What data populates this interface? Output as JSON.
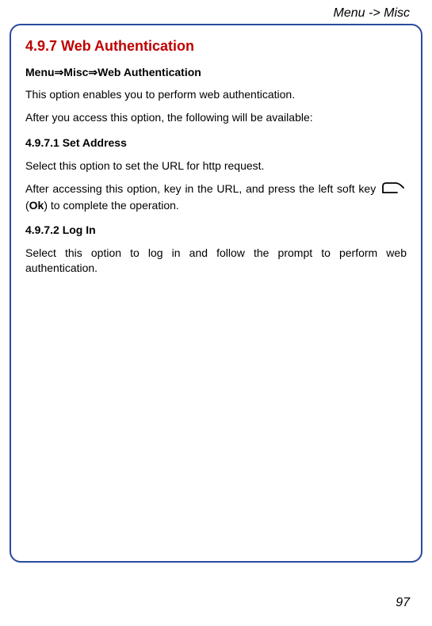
{
  "header": {
    "breadcrumb": "Menu -> Misc"
  },
  "section": {
    "heading": "4.9.7 Web Authentication",
    "path_prefix": "Menu",
    "path_mid": "Misc",
    "path_suffix": "Web Authentication",
    "intro1": "This option enables you to perform web authentication.",
    "intro2": "After you access this option, the following will be available:",
    "sub1": {
      "heading": "4.9.7.1 Set Address",
      "para1": "Select this option to set the URL for http request.",
      "para2_a": "After accessing this option, key in the URL, and press the left soft key ",
      "para2_b": " (",
      "ok": "Ok",
      "para2_c": ") to complete the operation."
    },
    "sub2": {
      "heading": "4.9.7.2 Log In",
      "para1": "Select this option to log in and follow the prompt to perform web authentication."
    }
  },
  "page_number": "97",
  "icons": {
    "soft_key": "soft-key-icon"
  },
  "arrow_glyph": "⇒"
}
